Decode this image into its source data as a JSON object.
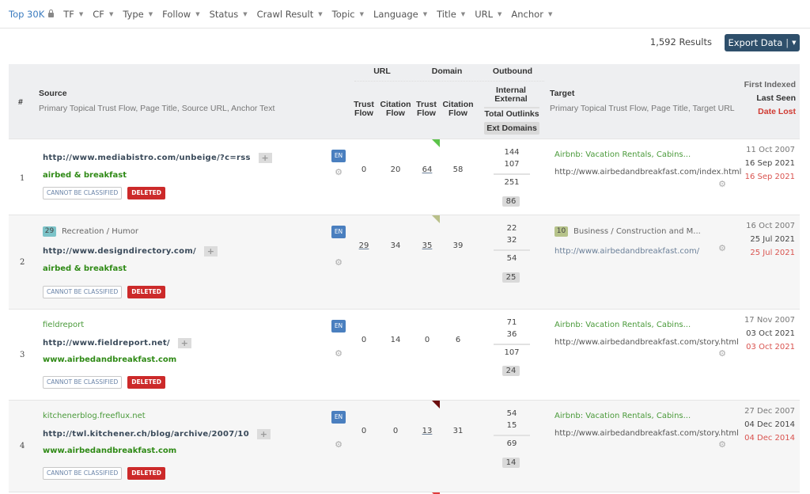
{
  "filters": [
    {
      "label": "Top 30K",
      "active": true,
      "locked": true
    },
    {
      "label": "TF"
    },
    {
      "label": "CF"
    },
    {
      "label": "Type"
    },
    {
      "label": "Follow"
    },
    {
      "label": "Status"
    },
    {
      "label": "Crawl Result"
    },
    {
      "label": "Topic"
    },
    {
      "label": "Language"
    },
    {
      "label": "Title"
    },
    {
      "label": "URL"
    },
    {
      "label": "Anchor"
    }
  ],
  "results_count": "1,592 Results",
  "export_label": "Export Data",
  "header": {
    "num": "#",
    "source": "Source",
    "source_sub": "Primary Topical Trust Flow, Page Title, Source URL, Anchor Text",
    "url_group": "URL",
    "domain_group": "Domain",
    "outbound_group": "Outbound",
    "trust_flow": "Trust Flow",
    "citation_flow": "Citation Flow",
    "internal": "Internal",
    "external": "External",
    "total_outlinks": "Total Outlinks",
    "ext_domains": "Ext Domains",
    "target": "Target",
    "target_sub": "Primary Topical Trust Flow, Page Title, Target URL",
    "first_indexed": "First Indexed",
    "last_seen": "Last Seen",
    "date_lost": "Date Lost"
  },
  "rows": [
    {
      "num": "1",
      "source_title": "",
      "source_url": "http://www.mediabistro.com/unbeige/?c=rss",
      "anchor": "airbed & breakfast",
      "tag_class": "CANNOT BE CLASSIFIED",
      "tag_status": "DELETED",
      "lang": "EN",
      "url_tf": "0",
      "url_cf": "20",
      "dom_tf": "64",
      "dom_cf": "58",
      "flag_color": "#5cc34a",
      "internal": "144",
      "external": "107",
      "total": "251",
      "ext_domains": "86",
      "target_title": "Airbnb: Vacation Rentals, Cabins...",
      "target_url": "http://www.airbedandbreakfast.com/index.html",
      "first_indexed": "11 Oct 2007",
      "last_seen": "16 Sep 2021",
      "date_lost": "16 Sep 2021"
    },
    {
      "num": "2",
      "source_topic_ttf": "29",
      "source_topic": "Recreation / Humor",
      "source_topic_color": "#7cc3c8",
      "source_url": "http://www.designdirectory.com/",
      "anchor": "airbed & breakfast",
      "tag_class": "CANNOT BE CLASSIFIED",
      "tag_status": "DELETED",
      "lang": "EN",
      "url_tf": "29",
      "url_cf": "34",
      "dom_tf": "35",
      "dom_cf": "39",
      "flag_color": "#b9c08a",
      "internal": "22",
      "external": "32",
      "total": "54",
      "ext_domains": "25",
      "target_topic_ttf": "10",
      "target_topic": "Business / Construction and M...",
      "target_topic_color": "#b6c38a",
      "target_url": "http://www.airbedandbreakfast.com/",
      "first_indexed": "16 Oct 2007",
      "last_seen": "25 Jul 2021",
      "date_lost": "25 Jul 2021"
    },
    {
      "num": "3",
      "source_title": "fieldreport",
      "source_url": "http://www.fieldreport.net/",
      "anchor": "www.airbedandbreakfast.com",
      "tag_class": "CANNOT BE CLASSIFIED",
      "tag_status": "DELETED",
      "lang": "EN",
      "url_tf": "0",
      "url_cf": "14",
      "dom_tf": "0",
      "dom_cf": "6",
      "internal": "71",
      "external": "36",
      "total": "107",
      "ext_domains": "24",
      "target_title": "Airbnb: Vacation Rentals, Cabins...",
      "target_url": "http://www.airbedandbreakfast.com/story.html",
      "first_indexed": "17 Nov 2007",
      "last_seen": "03 Oct 2021",
      "date_lost": "03 Oct 2021"
    },
    {
      "num": "4",
      "source_title": "kitchenerblog.freeflux.net",
      "source_url": "http://twl.kitchener.ch/blog/archive/2007/10",
      "anchor": "www.airbedandbreakfast.com",
      "tag_class": "CANNOT BE CLASSIFIED",
      "tag_status": "DELETED",
      "lang": "EN",
      "url_tf": "0",
      "url_cf": "0",
      "dom_tf": "13",
      "dom_cf": "31",
      "flag_color": "#6b0d0d",
      "internal": "54",
      "external": "15",
      "total": "69",
      "ext_domains": "14",
      "target_title": "Airbnb: Vacation Rentals, Cabins...",
      "target_url": "http://www.airbedandbreakfast.com/story.html",
      "first_indexed": "27 Dec 2007",
      "last_seen": "04 Dec 2014",
      "date_lost": "04 Dec 2014"
    }
  ],
  "next_row_flag_color": "#e03b3b"
}
